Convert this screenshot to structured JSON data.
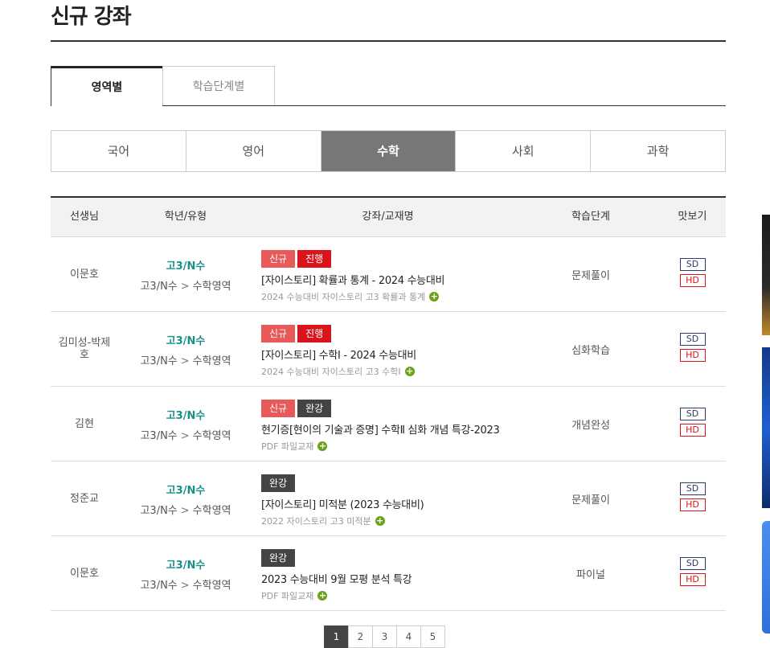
{
  "page_title": "신규 강좌",
  "main_tabs": [
    {
      "label": "영역별",
      "active": true
    },
    {
      "label": "학습단계별",
      "active": false
    }
  ],
  "subject_tabs": [
    {
      "label": "국어",
      "active": false
    },
    {
      "label": "영어",
      "active": false
    },
    {
      "label": "수학",
      "active": true
    },
    {
      "label": "사회",
      "active": false
    },
    {
      "label": "과학",
      "active": false
    }
  ],
  "table": {
    "headers": [
      "선생님",
      "학년/유형",
      "강좌/교재명",
      "학습단계",
      "맛보기"
    ],
    "rows": [
      {
        "teacher": "이문호",
        "grade": "고3/N수",
        "grade_path_1": "고3/N수",
        "grade_path_2": "수학영역",
        "badges": [
          {
            "label": "신규",
            "type": "new"
          },
          {
            "label": "진행",
            "type": "ing"
          }
        ],
        "title": "[자이스토리] 확률과 통계 - 2024 수능대비",
        "subtitle": "2024 수능대비 자이스토리 고3 확률과 통계",
        "stage": "문제풀이",
        "sd": "SD",
        "hd": "HD"
      },
      {
        "teacher": "김미성-박제호",
        "grade": "고3/N수",
        "grade_path_1": "고3/N수",
        "grade_path_2": "수학영역",
        "badges": [
          {
            "label": "신규",
            "type": "new"
          },
          {
            "label": "진행",
            "type": "ing"
          }
        ],
        "title": "[자이스토리] 수학Ⅰ - 2024 수능대비",
        "subtitle": "2024 수능대비 자이스토리 고3 수학Ⅰ",
        "stage": "심화학습",
        "sd": "SD",
        "hd": "HD"
      },
      {
        "teacher": "김현",
        "grade": "고3/N수",
        "grade_path_1": "고3/N수",
        "grade_path_2": "수학영역",
        "badges": [
          {
            "label": "신규",
            "type": "new"
          },
          {
            "label": "완강",
            "type": "done"
          }
        ],
        "title": "현기증[현이의 기술과 증명] 수학Ⅱ 심화 개념 특강-2023",
        "subtitle": "PDF 파일교재",
        "stage": "개념완성",
        "sd": "SD",
        "hd": "HD"
      },
      {
        "teacher": "정준교",
        "grade": "고3/N수",
        "grade_path_1": "고3/N수",
        "grade_path_2": "수학영역",
        "badges": [
          {
            "label": "완강",
            "type": "done"
          }
        ],
        "title": "[자이스토리] 미적분 (2023 수능대비)",
        "subtitle": "2022 자이스토리 고3 미적분",
        "stage": "문제풀이",
        "sd": "SD",
        "hd": "HD"
      },
      {
        "teacher": "이문호",
        "grade": "고3/N수",
        "grade_path_1": "고3/N수",
        "grade_path_2": "수학영역",
        "badges": [
          {
            "label": "완강",
            "type": "done"
          }
        ],
        "title": "2023 수능대비 9월 모평 분석 특강",
        "subtitle": "PDF 파일교재",
        "stage": "파이널",
        "sd": "SD",
        "hd": "HD"
      }
    ]
  },
  "pagination": [
    "1",
    "2",
    "3",
    "4",
    "5"
  ],
  "icons": {
    "plus": "plus-circle-icon",
    "chevron": "chevron-right-icon"
  },
  "colors": {
    "accent_teal": "#1a8f8a",
    "badge_new": "#e85a5a",
    "badge_ing": "#d9141a",
    "badge_done": "#444444",
    "plus_green": "#6aa21a"
  }
}
